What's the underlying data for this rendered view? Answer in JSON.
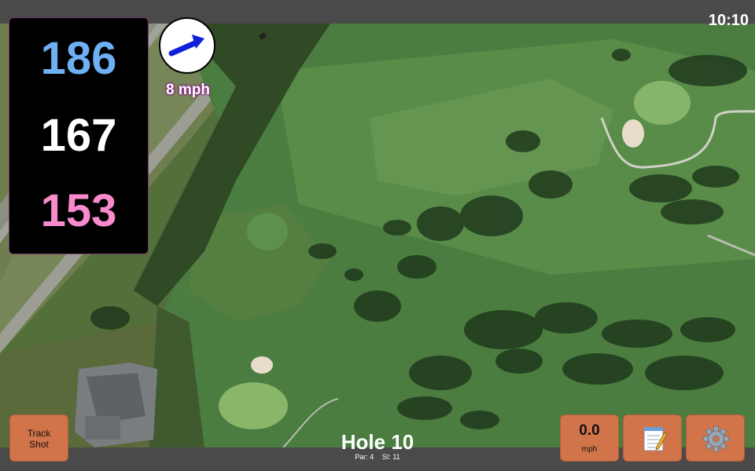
{
  "status": {
    "time": "10:10"
  },
  "yardages": {
    "back": "186",
    "middle": "167",
    "front": "153"
  },
  "wind": {
    "speed_label": "8 mph",
    "icon": "arrow-icon"
  },
  "buttons": {
    "track_shot": "Track\nShot",
    "speed_value": "0.0",
    "speed_unit": "mph",
    "notes_icon": "notepad-icon",
    "settings_icon": "gear-icon"
  },
  "hole": {
    "title": "Hole 10",
    "par": "Par: 4",
    "si": "SI: 11"
  },
  "colors": {
    "back": "#6fb0f5",
    "middle": "#ffffff",
    "front": "#f98bcc",
    "button": "#d2744a"
  }
}
